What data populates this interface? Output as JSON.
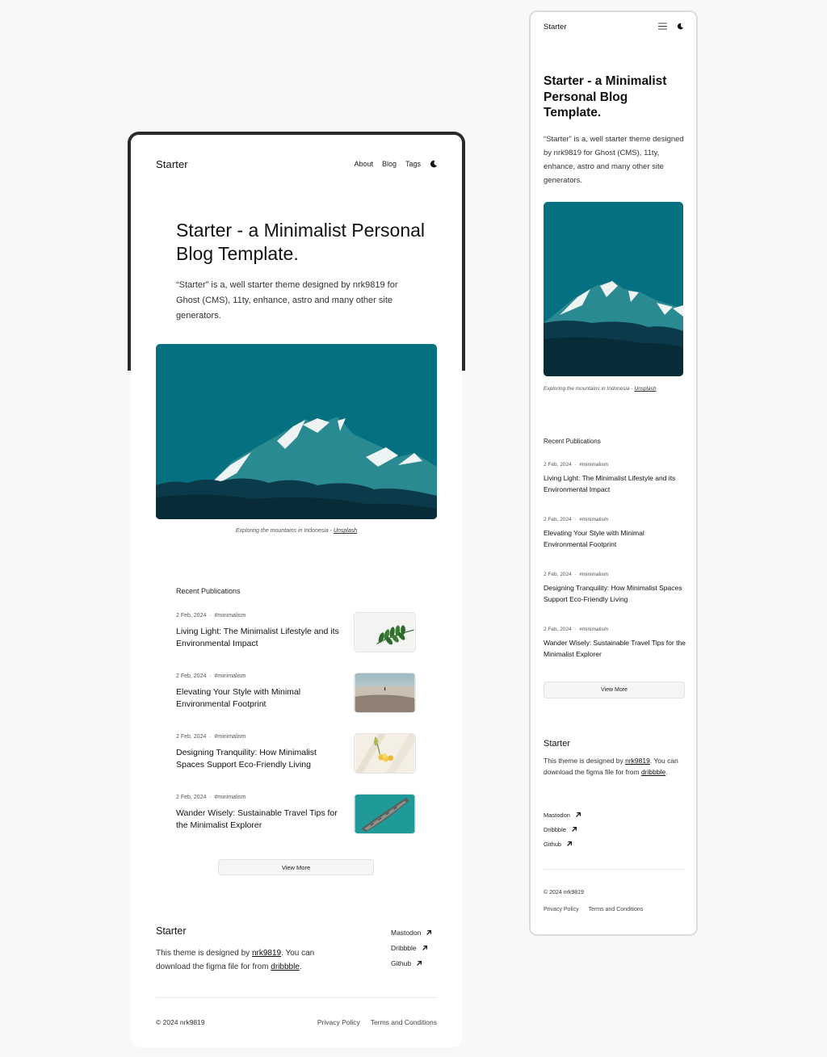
{
  "site": {
    "logo": "Starter"
  },
  "nav": {
    "items": [
      "About",
      "Blog",
      "Tags"
    ]
  },
  "icons": {
    "theme_toggle": "moon-icon",
    "menu": "hamburger-menu-icon",
    "external": "arrow-up-right-icon"
  },
  "colors": {
    "accent_teal": "#05707f",
    "text": "#111111"
  },
  "hero": {
    "title": "Starter - a Minimalist Personal Blog Template.",
    "description": "“Starter” is a, well starter theme designed by nrk9819 for Ghost (CMS), 11ty, enhance, astro and many other site generators.",
    "caption_text": "Exploring the mountains in Indonesia - ",
    "caption_link": "Unsplash"
  },
  "recent": {
    "heading": "Recent Publications",
    "posts": [
      {
        "date": "2 Feb, 2024",
        "tag": "#minimalism",
        "title": "Living Light: The Minimalist Lifestyle and its Environmental Impact"
      },
      {
        "date": "2 Feb, 2024",
        "tag": "#minimalism",
        "title": "Elevating Your Style with Minimal Environmental Footprint"
      },
      {
        "date": "2 Feb, 2024",
        "tag": "#minimalism",
        "title": "Designing Tranquility: How Minimalist Spaces Support Eco-Friendly Living"
      },
      {
        "date": "2 Feb, 2024",
        "tag": "#minimalism",
        "title": "Wander Wisely: Sustainable Travel Tips for the Minimalist Explorer"
      }
    ],
    "view_more": "View More"
  },
  "footer": {
    "title": "Starter",
    "desc_1": "This theme is designed by ",
    "author_link": "nrk9819",
    "desc_2": ". You can download the figma file for from ",
    "dribbble_link": "dribbble",
    "desc_3": ".",
    "social": [
      "Mastodon",
      "Dribbble",
      "Github"
    ],
    "copyright": "© 2024 nrk9819",
    "privacy": "Privacy Policy",
    "terms": "Terms and Conditions"
  }
}
